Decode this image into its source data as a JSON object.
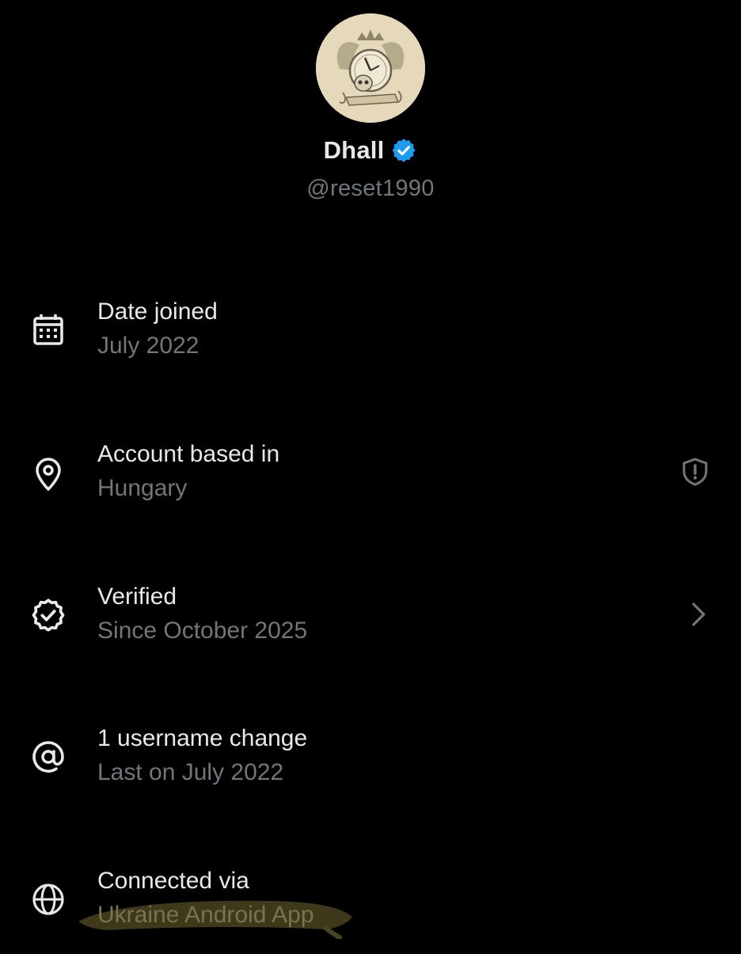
{
  "profile": {
    "display_name": "Dhall",
    "handle": "@reset1990",
    "verified": true,
    "badge_color": "#1d9bf0"
  },
  "rows": [
    {
      "icon": "calendar-icon",
      "title": "Date joined",
      "subtitle": "July 2022"
    },
    {
      "icon": "location-pin-icon",
      "title": "Account based in",
      "subtitle": "Hungary",
      "action_icon": "shield-alert-icon"
    },
    {
      "icon": "verified-badge-outline-icon",
      "title": "Verified",
      "subtitle": "Since October 2025",
      "action_icon": "chevron-right-icon"
    },
    {
      "icon": "at-sign-icon",
      "title": "1 username change",
      "subtitle": "Last on July 2022"
    },
    {
      "icon": "globe-icon",
      "title": "Connected via",
      "subtitle": "Ukraine Android App",
      "highlight_color": "#4a4320"
    }
  ],
  "colors": {
    "background": "#000000",
    "primary_text": "#e7e9ea",
    "secondary_text": "#71767b"
  }
}
